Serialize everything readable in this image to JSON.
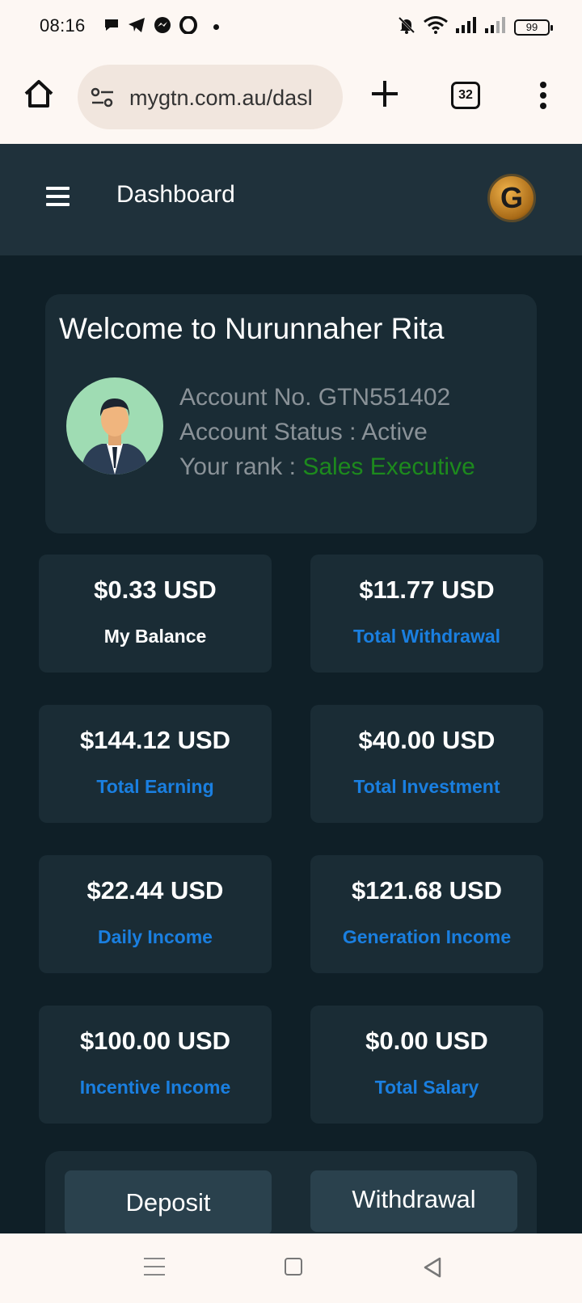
{
  "status_bar": {
    "time": "08:16",
    "battery": "99",
    "left_icons": [
      "chat-bubble-icon",
      "telegram-icon",
      "messenger-icon",
      "opera-icon"
    ],
    "right_icons": [
      "mute-bell-icon",
      "wifi-icon",
      "signal-icon",
      "signal-icon-2",
      "battery-icon"
    ]
  },
  "browser": {
    "url": "mygtn.com.au/dasl",
    "tab_count": "32"
  },
  "header": {
    "title": "Dashboard",
    "logo_letter": "G"
  },
  "welcome": {
    "title": "Welcome to Nurunnaher Rita",
    "account_no": "Account No. GTN551402",
    "status": "Account Status : Active",
    "rank_label": "Your rank : ",
    "rank_value": "Sales Executive"
  },
  "stats": [
    {
      "amount": "$0.33 USD",
      "label": "My Balance"
    },
    {
      "amount": "$11.77 USD",
      "label": "Total Withdrawal"
    },
    {
      "amount": "$144.12 USD",
      "label": "Total Earning"
    },
    {
      "amount": "$40.00 USD",
      "label": "Total Investment"
    },
    {
      "amount": "$22.44 USD",
      "label": "Daily Income"
    },
    {
      "amount": "$121.68 USD",
      "label": "Generation Income"
    },
    {
      "amount": "$100.00 USD",
      "label": "Incentive Income"
    },
    {
      "amount": "$0.00 USD",
      "label": "Total Salary"
    }
  ],
  "actions": {
    "deposit": "Deposit",
    "withdrawal": "Withdrawal"
  },
  "colors": {
    "page_bg": "#0f1f27",
    "card_bg": "#1a2c35",
    "header_bg": "#1f313b",
    "link_blue": "#1a7fe0",
    "rank_green": "#1d8a1d"
  }
}
